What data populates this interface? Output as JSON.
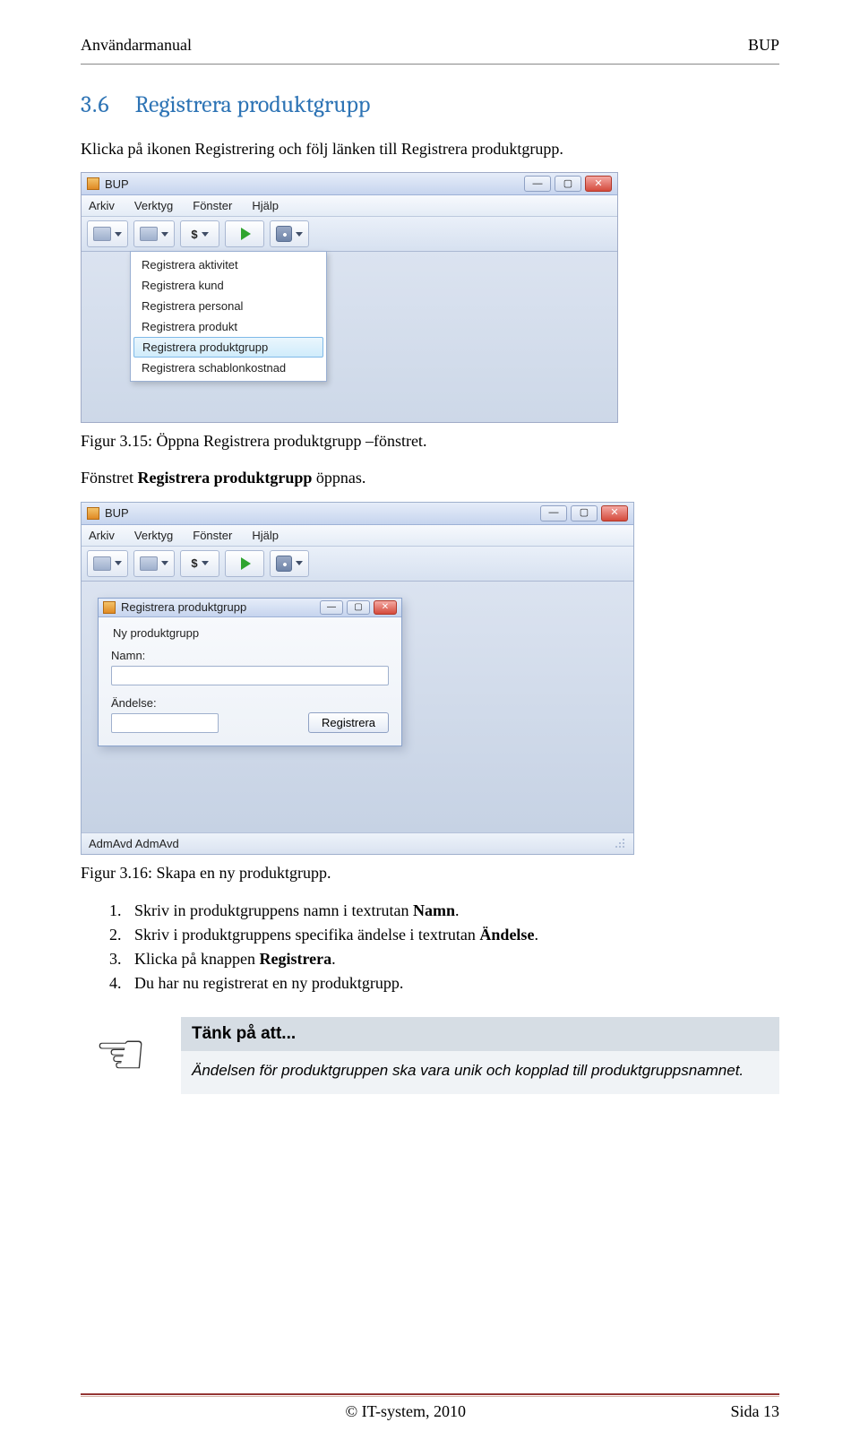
{
  "header": {
    "left": "Användarmanual",
    "right": "BUP"
  },
  "section": {
    "number": "3.6",
    "title": "Registrera produktgrupp"
  },
  "intro": "Klicka på ikonen Registrering och följ länken till Registrera produktgrupp.",
  "fig1_caption": "Figur 3.15: Öppna Registrera produktgrupp –fönstret.",
  "after_fig1": {
    "prefix": "Fönstret ",
    "bold": "Registrera produktgrupp",
    "suffix": " öppnas."
  },
  "fig2_caption": "Figur 3.16: Skapa en ny produktgrupp.",
  "steps": [
    {
      "pre": "Skriv in produktgruppens namn i textrutan ",
      "bold": "Namn",
      "post": "."
    },
    {
      "pre": "Skriv i produktgruppens specifika ändelse i textrutan ",
      "bold": "Ändelse",
      "post": "."
    },
    {
      "pre": "Klicka på knappen ",
      "bold": "Registrera",
      "post": "."
    },
    {
      "pre": "Du har nu registrerat en ny produktgrupp.",
      "bold": "",
      "post": ""
    }
  ],
  "callout": {
    "title": "Tänk på att...",
    "body": "Ändelsen för produktgruppen ska vara unik och kopplad till produktgruppsnamnet."
  },
  "footer": {
    "center": "© IT-system, 2010",
    "right": "Sida 13"
  },
  "app": {
    "title": "BUP",
    "menus": [
      "Arkiv",
      "Verktyg",
      "Fönster",
      "Hjälp"
    ],
    "toolbar_dollar": "$",
    "dropdown": [
      "Registrera aktivitet",
      "Registrera kund",
      "Registrera personal",
      "Registrera produkt",
      "Registrera produktgrupp",
      "Registrera schablonkostnad"
    ],
    "dropdown_selected_index": 4,
    "modal": {
      "title": "Registrera produktgrupp",
      "group": "Ny produktgrupp",
      "label_name": "Namn:",
      "label_suffix": "Ändelse:",
      "button": "Registrera"
    },
    "status": "AdmAvd AdmAvd",
    "win_min": "—",
    "win_max": "▢",
    "win_close": "✕"
  }
}
